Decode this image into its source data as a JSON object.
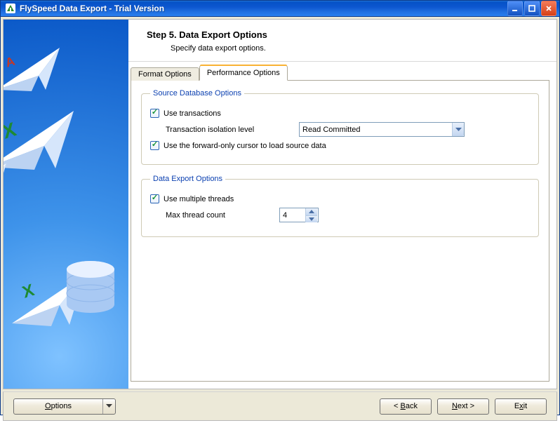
{
  "window": {
    "title": "FlySpeed Data Export - Trial Version"
  },
  "header": {
    "title": "Step 5. Data Export Options",
    "subtitle": "Specify data export options."
  },
  "tabs": {
    "format": "Format Options",
    "performance": "Performance Options"
  },
  "source_group": {
    "legend": "Source Database Options",
    "use_transactions": "Use transactions",
    "isolation_label": "Transaction isolation level",
    "isolation_value": "Read Committed",
    "forward_only": "Use the forward-only cursor to load source data"
  },
  "export_group": {
    "legend": "Data Export Options",
    "multi_threads": "Use multiple threads",
    "max_threads_label": "Max thread count",
    "max_threads_value": "4"
  },
  "footer": {
    "options": "Options",
    "back": "< Back",
    "next": "Next >",
    "exit": "Exit"
  }
}
